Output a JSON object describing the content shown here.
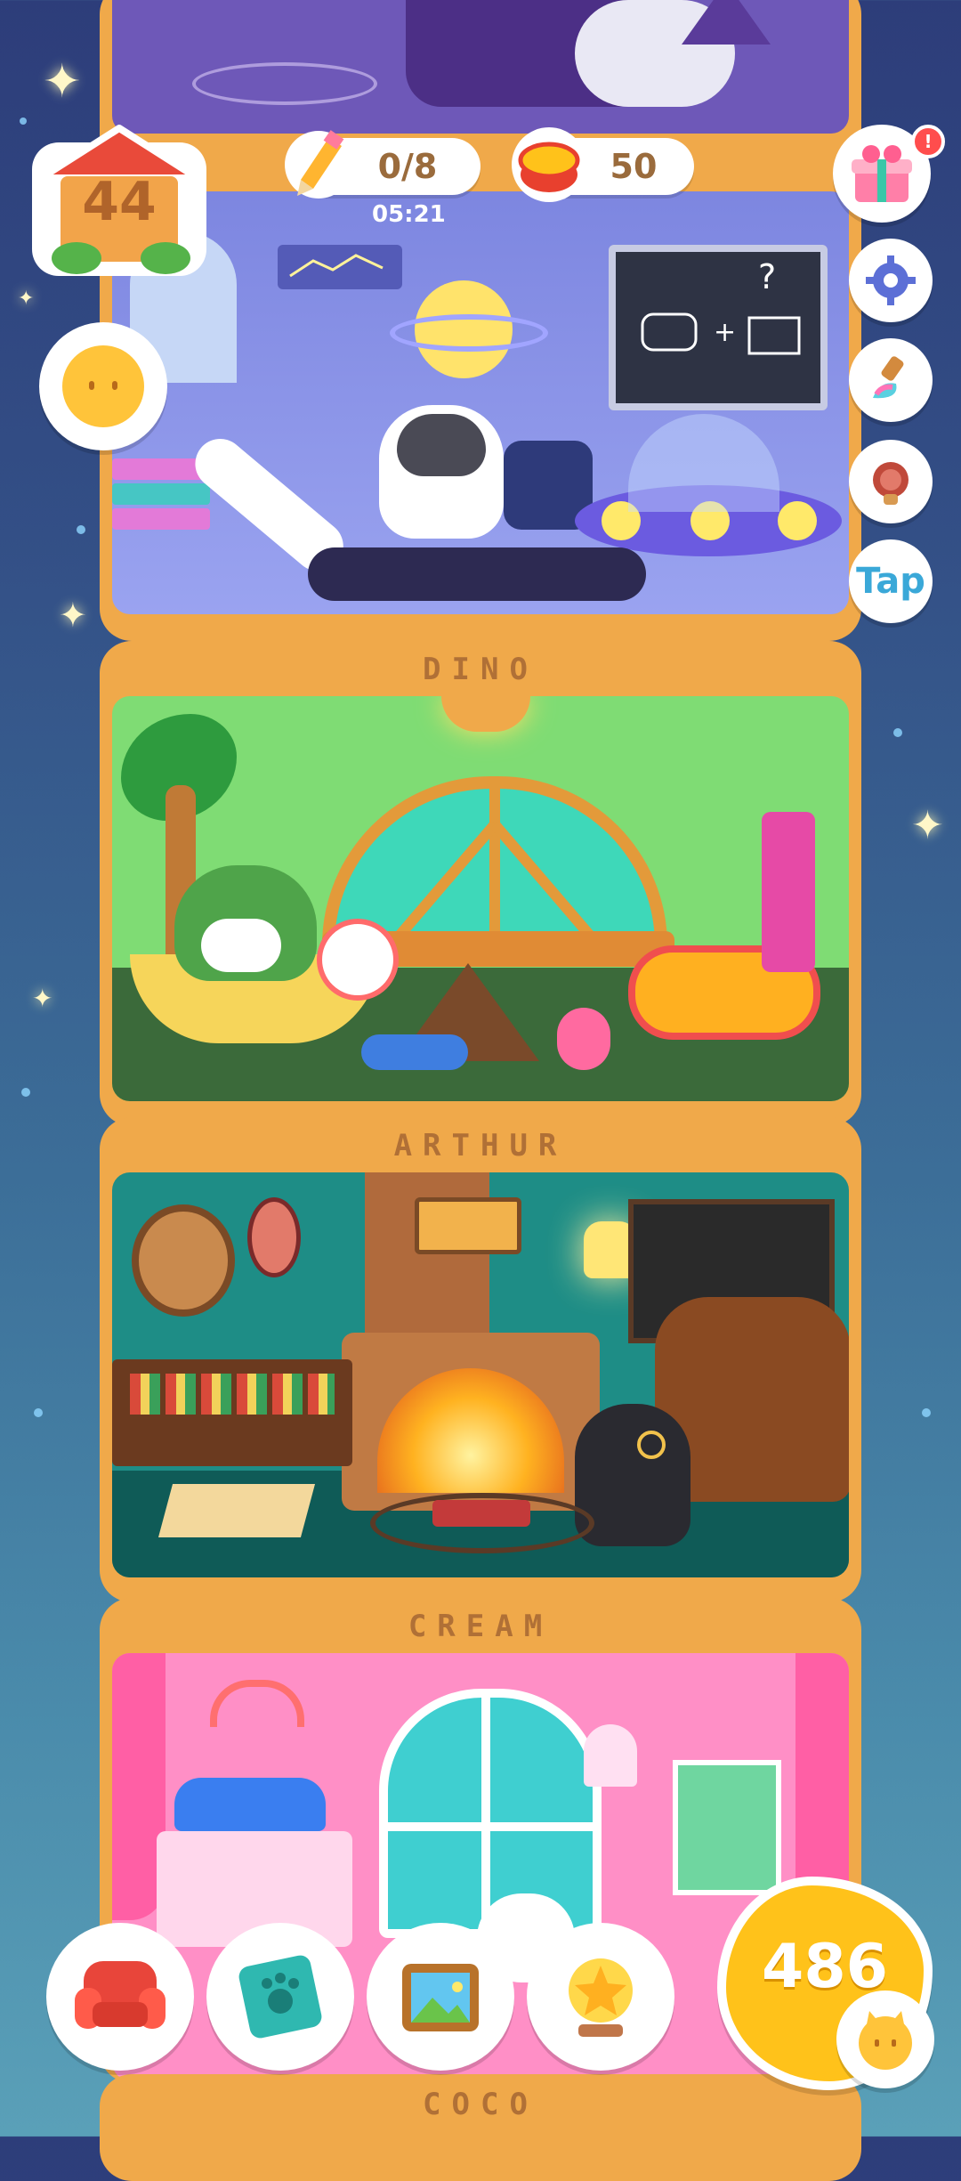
{
  "house_level": "44",
  "hud": {
    "pencil_count": "0/8",
    "timer": "05:21",
    "coins": "50",
    "tap_label": "Tap"
  },
  "rooms": [
    {
      "id": "wizard",
      "label": ""
    },
    {
      "id": "space",
      "label": ""
    },
    {
      "id": "dino",
      "label": "DINO"
    },
    {
      "id": "arthur",
      "label": "ARTHUR"
    },
    {
      "id": "cream",
      "label": "CREAM"
    },
    {
      "id": "coco",
      "label": "COCO"
    }
  ],
  "chalkboard_text": "?",
  "bottom_bar": {
    "cat_food_count": "486"
  },
  "icons": {
    "house": "house-icon",
    "pencil": "pencil-icon",
    "coin_can": "tuna-can-icon",
    "gift": "gift-icon",
    "settings": "gear-icon",
    "brush": "paint-brush-icon",
    "food": "sausage-icon",
    "cat_face": "cat-face-icon",
    "furniture": "armchair-icon",
    "book": "paw-book-icon",
    "photo": "photo-frame-icon",
    "trophy": "star-trophy-icon"
  },
  "colors": {
    "accent_orange": "#f0a94a",
    "badge_red": "#ff4d4d",
    "tap_blue": "#3aa8d8",
    "coin_yellow": "#ffc21a"
  }
}
